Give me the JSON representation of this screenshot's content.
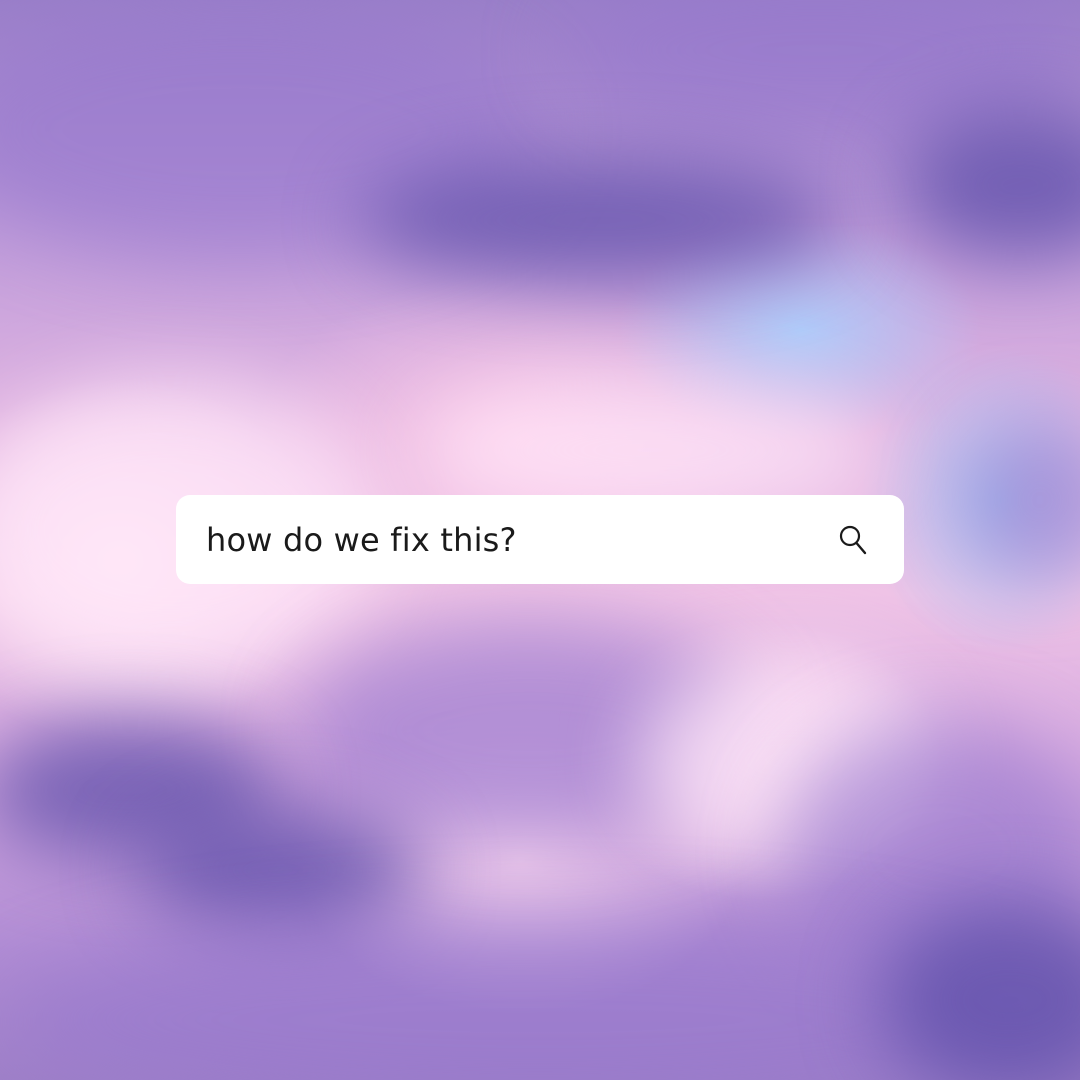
{
  "search": {
    "query": "how do we fix this?",
    "icon": "search-icon"
  },
  "colors": {
    "search_bar_background": "#ffffff",
    "search_text": "#1a1a1a",
    "sky_dark_cloud": "#5c4ea8",
    "sky_pink": "#efc3e6",
    "sky_blue": "#aad2ff"
  }
}
